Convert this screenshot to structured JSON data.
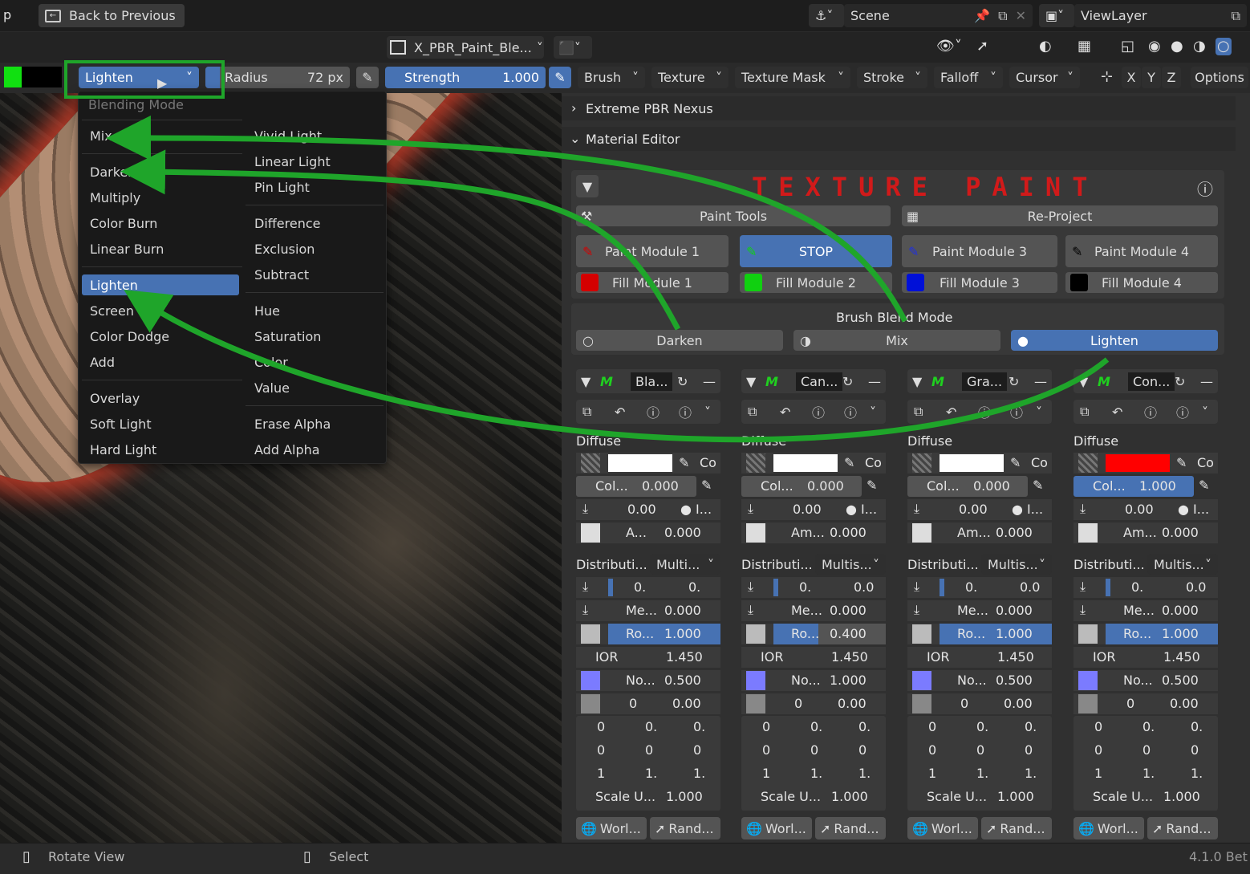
{
  "topbar": {
    "left_fragment": "p",
    "back_label": "Back to Previous",
    "scene_name": "Scene",
    "view_layer": "ViewLayer"
  },
  "header2": {
    "image_name": "X_PBR_Paint_Ble..."
  },
  "toolbar": {
    "blend_value": "Lighten",
    "radius_label": "Radius",
    "radius_value": "72 px",
    "strength_label": "Strength",
    "strength_value": "1.000",
    "menus": [
      "Brush",
      "Texture",
      "Texture Mask",
      "Stroke",
      "Falloff",
      "Cursor"
    ],
    "axes": [
      "X",
      "Y",
      "Z"
    ],
    "options_label": "Options"
  },
  "blend_menu": {
    "title": "Blending Mode",
    "left_col": [
      "Mix",
      "Darken",
      "Multiply",
      "Color Burn",
      "Linear Burn",
      "Lighten",
      "Screen",
      "Color Dodge",
      "Add",
      "Overlay",
      "Soft Light",
      "Hard Light"
    ],
    "right_col": [
      "Vivid Light",
      "Linear Light",
      "Pin Light",
      "Difference",
      "Exclusion",
      "Subtract",
      "Hue",
      "Saturation",
      "Color",
      "Value",
      "Erase Alpha",
      "Add Alpha"
    ],
    "selected": "Lighten"
  },
  "panels": {
    "nexus_title": "Extreme PBR Nexus",
    "material_editor_title": "Material Editor",
    "banner": "TEXTURE PAINT",
    "paint_tools": "Paint Tools",
    "re_project": "Re-Project",
    "paint_modules": [
      "Paint Module 1",
      "STOP",
      "Paint Module 3",
      "Paint Module 4"
    ],
    "fill_modules": [
      "Fill Module 1",
      "Fill Module 2",
      "Fill Module 3",
      "Fill Module 4"
    ],
    "fill_colors": [
      "#d40000",
      "#10d010",
      "#0010d8",
      "#000000"
    ],
    "brush_blend_title": "Brush Blend Mode",
    "brush_blend_options": [
      "Darken",
      "Mix",
      "Lighten"
    ],
    "brush_blend_selected": "Lighten"
  },
  "columns": [
    {
      "name": "Bla...",
      "diffuse": "Diffuse",
      "co": "Co",
      "col_label": "Col...",
      "col_value": "0.000",
      "v1": "0.00",
      "i": "I...",
      "a_label": "A...",
      "a_value": "0.000",
      "dist": "Distributi...",
      "multi": "Multi...",
      "r1a": "0.",
      "r1b": "0.",
      "me_label": "Me...",
      "me_value": "0.000",
      "ro_label": "Ro...",
      "ro_value": "1.000",
      "ior_label": "IOR",
      "ior_value": "1.450",
      "no_label": "No...",
      "no_value": "0.500",
      "z1": "0",
      "z2": "0.00",
      "g": [
        "0",
        "0.",
        "0.",
        "0",
        "0",
        "0",
        "1",
        "1.",
        "1."
      ],
      "scale_label": "Scale U...",
      "scale_value": "1.000",
      "world": "Worl...",
      "rand": "Rand...",
      "swatch": "#ffffff"
    },
    {
      "name": "Can...",
      "diffuse": "Diffuse",
      "co": "Co",
      "col_label": "Col...",
      "col_value": "0.000",
      "v1": "0.00",
      "i": "I...",
      "a_label": "Am...",
      "a_value": "0.000",
      "dist": "Distributi...",
      "multi": "Multis...",
      "r1a": "0.",
      "r1b": "0.0",
      "me_label": "Me...",
      "me_value": "0.000",
      "ro_label": "Ro...",
      "ro_value": "0.400",
      "ior_label": "IOR",
      "ior_value": "1.450",
      "no_label": "No...",
      "no_value": "1.000",
      "z1": "0",
      "z2": "0.00",
      "g": [
        "0",
        "0.",
        "0.",
        "0",
        "0",
        "0",
        "1",
        "1.",
        "1."
      ],
      "scale_label": "Scale U...",
      "scale_value": "1.000",
      "world": "Worl...",
      "rand": "Rand...",
      "swatch": "#ffffff"
    },
    {
      "name": "Gra...",
      "diffuse": "Diffuse",
      "co": "Co",
      "col_label": "Col...",
      "col_value": "0.000",
      "v1": "0.00",
      "i": "I...",
      "a_label": "Am...",
      "a_value": "0.000",
      "dist": "Distributi...",
      "multi": "Multis...",
      "r1a": "0.",
      "r1b": "0.0",
      "me_label": "Me...",
      "me_value": "0.000",
      "ro_label": "Ro...",
      "ro_value": "1.000",
      "ior_label": "IOR",
      "ior_value": "1.450",
      "no_label": "No...",
      "no_value": "0.500",
      "z1": "0",
      "z2": "0.00",
      "g": [
        "0",
        "0.",
        "0.",
        "0",
        "0",
        "0",
        "1",
        "1.",
        "1."
      ],
      "scale_label": "Scale U...",
      "scale_value": "1.000",
      "world": "Worl...",
      "rand": "Rand...",
      "swatch": "#ffffff"
    },
    {
      "name": "Con...",
      "diffuse": "Diffuse",
      "co": "Co",
      "col_label": "Col...",
      "col_value": "1.000",
      "v1": "0.00",
      "i": "I...",
      "a_label": "Am...",
      "a_value": "0.000",
      "dist": "Distributi...",
      "multi": "Multis...",
      "r1a": "0.",
      "r1b": "0.0",
      "me_label": "Me...",
      "me_value": "0.000",
      "ro_label": "Ro...",
      "ro_value": "1.000",
      "ior_label": "IOR",
      "ior_value": "1.450",
      "no_label": "No...",
      "no_value": "0.500",
      "z1": "0",
      "z2": "0.00",
      "g": [
        "0",
        "0.",
        "0.",
        "0",
        "0",
        "0",
        "1",
        "1.",
        "1."
      ],
      "scale_label": "Scale U...",
      "scale_value": "1.000",
      "world": "Worl...",
      "rand": "Rand...",
      "swatch": "#ff0000"
    }
  ],
  "statusbar": {
    "rotate": "Rotate View",
    "select": "Select",
    "version": "4.1.0 Bet"
  },
  "colors": {
    "accent": "#4772b3",
    "annotation": "#1fa52a",
    "banner": "#d11a1a"
  }
}
